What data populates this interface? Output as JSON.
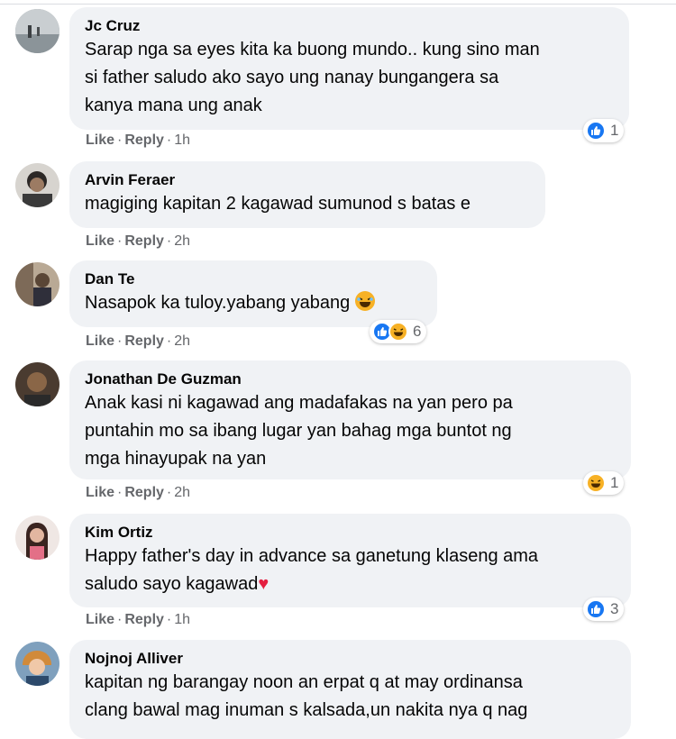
{
  "comments": [
    {
      "author": "Jc Cruz",
      "lines": [
        "Sarap nga sa eyes kita ka buong mundo.. kung sino man",
        "si father saludo ako sayo ung nanay bungangera sa",
        "kanya mana ung anak"
      ],
      "like": "Like",
      "reply": "Reply",
      "time": "1h",
      "reaction_count": "1",
      "reactions": [
        "like-icon"
      ]
    },
    {
      "author": "Arvin Feraer",
      "lines": [
        "magiging kapitan 2 kagawad sumunod s batas e"
      ],
      "like": "Like",
      "reply": "Reply",
      "time": "2h"
    },
    {
      "author": "Dan Te",
      "lines": [
        "Nasapok ka tuloy.yabang yabang"
      ],
      "like": "Like",
      "reply": "Reply",
      "time": "2h",
      "reaction_count": "6",
      "reactions": [
        "like-icon",
        "haha-icon"
      ]
    },
    {
      "author": "Jonathan De Guzman",
      "lines": [
        "Anak kasi ni kagawad ang madafakas na yan pero pa",
        "puntahin mo sa ibang lugar yan bahag mga buntot ng",
        "mga hinayupak na yan"
      ],
      "like": "Like",
      "reply": "Reply",
      "time": "2h",
      "reaction_count": "1",
      "reactions": [
        "haha-icon"
      ]
    },
    {
      "author": "Kim Ortiz",
      "lines": [
        "Happy father's day in advance sa ganetung klaseng ama",
        "saludo sayo kagawad"
      ],
      "like": "Like",
      "reply": "Reply",
      "time": "1h",
      "reaction_count": "3",
      "reactions": [
        "like-icon"
      ]
    },
    {
      "author": "Nojnoj Alliver",
      "lines": [
        "kapitan ng barangay noon an erpat q at may ordinansa",
        "clang bawal mag inuman s kalsada,un nakita nya q nag"
      ]
    }
  ],
  "dot": "·",
  "colors": {
    "like": "#1877f2",
    "haha": "#f7b125",
    "heart": "#e41e3f",
    "bubble": "#f0f2f5"
  }
}
